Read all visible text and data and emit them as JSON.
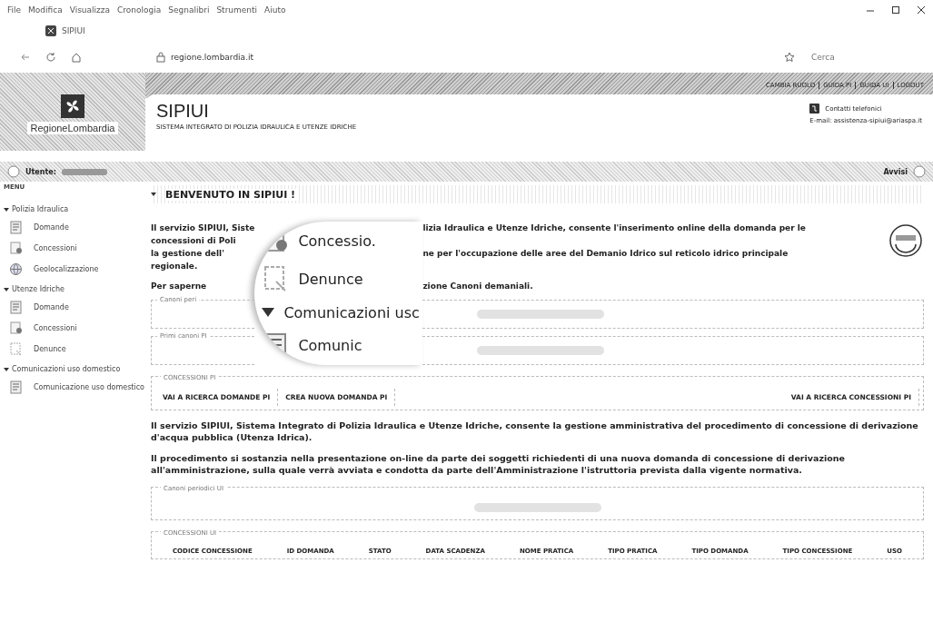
{
  "browser": {
    "menu": [
      "File",
      "Modifica",
      "Visualizza",
      "Cronologia",
      "Segnalibri",
      "Strumenti",
      "Aiuto"
    ],
    "tab": {
      "title": "SIPIUI"
    },
    "address": {
      "host": "regione.lombardia.it"
    },
    "search": {
      "placeholder": "Cerca"
    }
  },
  "header": {
    "logo": "RegioneLombardia",
    "title": "SIPIUI",
    "subtitle": "SISTEMA INTEGRATO DI POLIZIA IDRAULICA E UTENZE IDRICHE",
    "links": [
      "CAMBIA RUOLO",
      "GUIDA PI",
      "GUIDA UI",
      "LOGOUT"
    ],
    "contacts": "Contatti telefonici",
    "email": "E-mail: assistenza-sipiui@ariaspa.it"
  },
  "user_bar": {
    "label": "Utente:",
    "notices": "Avvisi"
  },
  "sidebar": {
    "title": "MENU",
    "groups": [
      {
        "label": "Polizia Idraulica",
        "expanded": true,
        "items": [
          {
            "label": "Domande",
            "kind": "form"
          },
          {
            "label": "Concessioni",
            "kind": "seal"
          },
          {
            "label": "Geolocalizzazione",
            "kind": "globe"
          }
        ]
      },
      {
        "label": "Utenze Idriche",
        "expanded": true,
        "items": [
          {
            "label": "Domande",
            "kind": "form"
          },
          {
            "label": "Concessioni",
            "kind": "seal"
          },
          {
            "label": "Denunce",
            "kind": "report"
          }
        ]
      },
      {
        "label": "Comunicazioni uso domestico",
        "expanded": true,
        "items": [
          {
            "label": "Comunicazione uso domestico",
            "kind": "form"
          }
        ]
      }
    ]
  },
  "main": {
    "title": "BENVENUTO IN SIPIUI !",
    "intro_lines": [
      {
        "left": "Il servizio SIPIUI, Siste",
        "right": "lizia Idraulica e Utenze Idriche, consente l'inserimento online della domanda per le"
      },
      {
        "left": "concessioni di Poli"
      },
      {
        "left": "la gestione dell'",
        "right": "ne per l'occupazione delle aree del Demanio Idrico sul reticolo idrico principale"
      },
      {
        "left": "regionale."
      }
    ],
    "more_left": "Per saperne",
    "more_right": "zione Canoni demaniali.",
    "lens": [
      {
        "label": "Concessio.",
        "kind": "seal"
      },
      {
        "label": "Denunce",
        "kind": "report"
      },
      {
        "label": "Comunicazioni usc",
        "kind": "group"
      },
      {
        "label": "Comunic",
        "kind": "form"
      }
    ],
    "fieldsets_top": [
      {
        "legend": "Canoni peri"
      },
      {
        "legend": "Primi canoni PI"
      }
    ],
    "concessioni_pi": {
      "legend": "CONCESSIONI PI",
      "buttons": [
        "VAI A RICERCA DOMANDE PI",
        "CREA NUOVA DOMANDA PI",
        "VAI A RICERCA CONCESSIONI PI"
      ]
    },
    "paragraphs": [
      "Il servizio SIPIUI, Sistema Integrato di Polizia Idraulica e Utenze Idriche, consente la gestione amministrativa del procedimento di concessione di derivazione d'acqua pubblica (Utenza Idrica).",
      "Il procedimento si sostanzia nella presentazione on-line da parte dei soggetti richiedenti di una nuova domanda di concessione di derivazione all'amministrazione, sulla quale verrà avviata e condotta da parte dell'Amministrazione l'istruttoria prevista dalla vigente normativa."
    ],
    "canoni_ui": {
      "legend": "Canoni periodici UI"
    },
    "concessioni_ui": {
      "legend": "CONCESSIONI UI",
      "columns": [
        "CODICE CONCESSIONE",
        "ID DOMANDA",
        "STATO",
        "DATA SCADENZA",
        "NOME PRATICA",
        "TIPO PRATICA",
        "TIPO DOMANDA",
        "TIPO CONCESSIONE",
        "USO"
      ]
    }
  }
}
